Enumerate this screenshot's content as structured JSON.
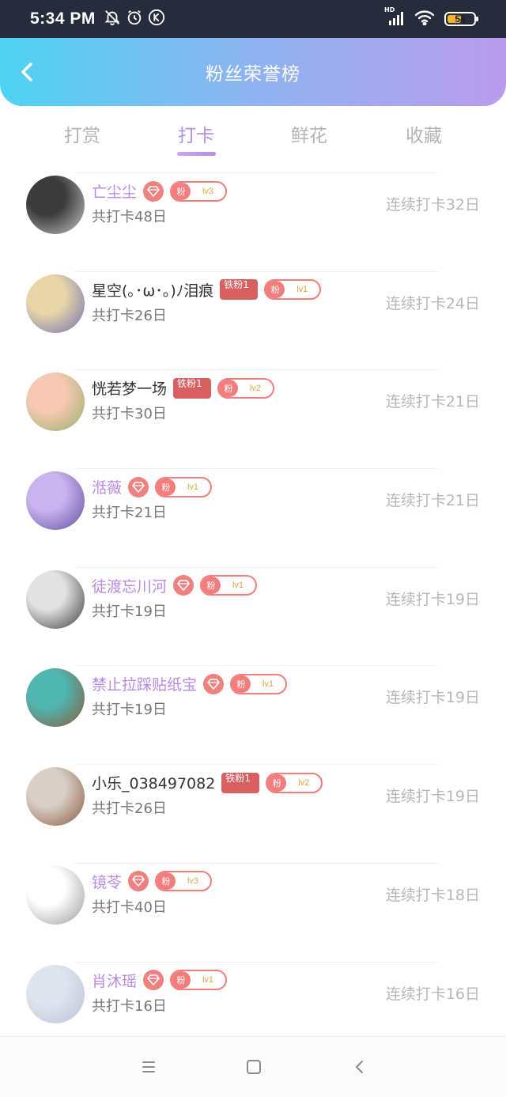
{
  "status_bar": {
    "time": "5:34 PM",
    "battery": "54",
    "battery_level": 0.54,
    "network_label": "HD",
    "icons": [
      "mute-bell-icon",
      "alarm-icon",
      "k-app-icon",
      "signal-icon",
      "wifi-icon",
      "battery-icon"
    ]
  },
  "header": {
    "title": "粉丝荣誉榜",
    "back_icon": "chevron-left-icon",
    "gradient": [
      "#4fd3f3",
      "#8fb3f0",
      "#b99cec"
    ]
  },
  "tabs": [
    {
      "label": "打赏",
      "active": false
    },
    {
      "label": "打卡",
      "active": true
    },
    {
      "label": "鲜花",
      "active": false
    },
    {
      "label": "收藏",
      "active": false
    }
  ],
  "accent_color": "#b48fe3",
  "badges": {
    "fan_label": "粉",
    "iron_label": "铁粉1"
  },
  "fans": [
    {
      "name": "亡尘尘",
      "vip": true,
      "badge": "diamond",
      "level": "lv3",
      "total": "共打卡48日",
      "streak": "连续打卡32日",
      "avatar_colors": [
        "#3b3b3b",
        "#c9c9c9"
      ]
    },
    {
      "name": "星空(｡･ω･｡)ﾉ泪痕",
      "vip": false,
      "badge": "iron",
      "level": "lv1",
      "total": "共打卡26日",
      "streak": "连续打卡24日",
      "avatar_colors": [
        "#e8d6a8",
        "#6d6fb0"
      ]
    },
    {
      "name": "恍若梦一场",
      "vip": false,
      "badge": "iron",
      "level": "lv2",
      "total": "共打卡30日",
      "streak": "连续打卡21日",
      "avatar_colors": [
        "#f7c9b4",
        "#96b06b"
      ]
    },
    {
      "name": "湉薇",
      "vip": true,
      "badge": "diamond",
      "level": "lv1",
      "total": "共打卡21日",
      "streak": "连续打卡21日",
      "avatar_colors": [
        "#c9b4ee",
        "#5f4fa0"
      ]
    },
    {
      "name": "徒渡忘川河",
      "vip": true,
      "badge": "diamond",
      "level": "lv1",
      "total": "共打卡19日",
      "streak": "连续打卡19日",
      "avatar_colors": [
        "#e2e2e2",
        "#3a3a3a"
      ]
    },
    {
      "name": "禁止拉踩贴纸宝",
      "vip": true,
      "badge": "diamond",
      "level": "lv1",
      "total": "共打卡19日",
      "streak": "连续打卡19日",
      "avatar_colors": [
        "#4fb6b0",
        "#8a5a3a"
      ]
    },
    {
      "name": "小乐_038497082",
      "vip": false,
      "badge": "iron",
      "level": "lv2",
      "total": "共打卡26日",
      "streak": "连续打卡19日",
      "avatar_colors": [
        "#d9cfc7",
        "#8a5a3f"
      ]
    },
    {
      "name": "镜苓",
      "vip": true,
      "badge": "diamond",
      "level": "lv3",
      "total": "共打卡40日",
      "streak": "连续打卡18日",
      "avatar_colors": [
        "#ffffff",
        "#9a9a9a"
      ]
    },
    {
      "name": "肖沐瑶",
      "vip": true,
      "badge": "diamond",
      "level": "lv1",
      "total": "共打卡16日",
      "streak": "连续打卡16日",
      "avatar_colors": [
        "#dfe4ef",
        "#b9c3d8"
      ]
    }
  ],
  "nav_bar": {
    "icons": [
      "menu-icon",
      "home-square-icon",
      "back-triangle-icon"
    ]
  }
}
